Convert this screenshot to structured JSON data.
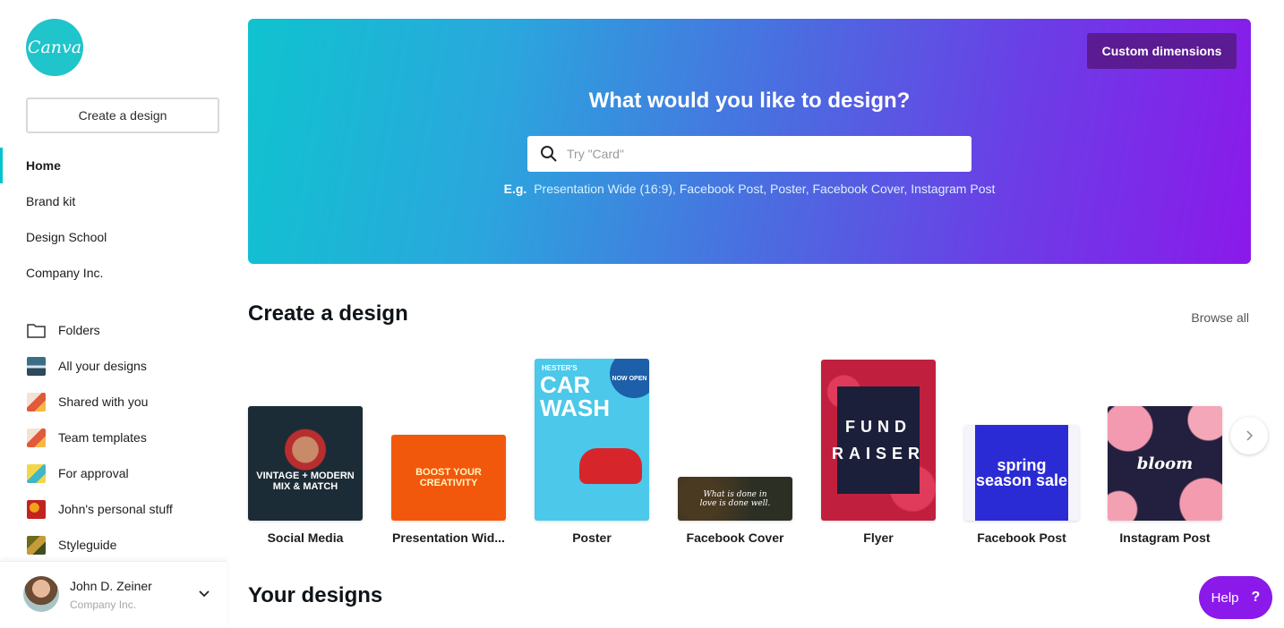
{
  "sidebar": {
    "logo_text": "Canva",
    "create_button": "Create a design",
    "nav": [
      {
        "label": "Home",
        "active": true
      },
      {
        "label": "Brand kit"
      },
      {
        "label": "Design School"
      },
      {
        "label": "Company Inc."
      }
    ],
    "folders": [
      {
        "label": "Folders",
        "icon": "folder-icon"
      },
      {
        "label": "All your designs",
        "icon": "designs-thumbnail"
      },
      {
        "label": "Shared with you",
        "icon": "shared-thumbnail"
      },
      {
        "label": "Team templates",
        "icon": "team-thumbnail"
      },
      {
        "label": "For approval",
        "icon": "approval-thumbnail"
      },
      {
        "label": "John's personal stuff",
        "icon": "personal-thumbnail"
      },
      {
        "label": "Styleguide",
        "icon": "styleguide-thumbnail"
      }
    ],
    "user": {
      "name": "John D. Zeiner",
      "org": "Company Inc."
    }
  },
  "hero": {
    "custom_button": "Custom dimensions",
    "title": "What would you like to design?",
    "search_placeholder": "Try \"Card\"",
    "examples_prefix": "E.g.",
    "examples": [
      "Presentation Wide (16:9)",
      "Facebook Post",
      "Poster",
      "Facebook Cover",
      "Instagram Post"
    ]
  },
  "create_section": {
    "title": "Create a design",
    "browse_all": "Browse all",
    "cards": [
      {
        "label": "Social Media",
        "art": "VINTAGE + MODERN MIX & MATCH"
      },
      {
        "label": "Presentation Wid...",
        "art": "BOOST YOUR CREATIVITY"
      },
      {
        "label": "Poster",
        "art": "CAR WASH",
        "badge": "NOW OPEN",
        "top": "HESTER'S"
      },
      {
        "label": "Facebook Cover",
        "art": "What is done in love is done well."
      },
      {
        "label": "Flyer",
        "art": "FUND RAISER"
      },
      {
        "label": "Facebook Post",
        "art": "spring season sale"
      },
      {
        "label": "Instagram Post",
        "art": "bloom"
      }
    ]
  },
  "your_designs": {
    "title": "Your designs"
  },
  "help": {
    "label": "Help",
    "icon": "?"
  },
  "colors": {
    "brand": "#00c4cc",
    "purple": "#8b19ea"
  }
}
